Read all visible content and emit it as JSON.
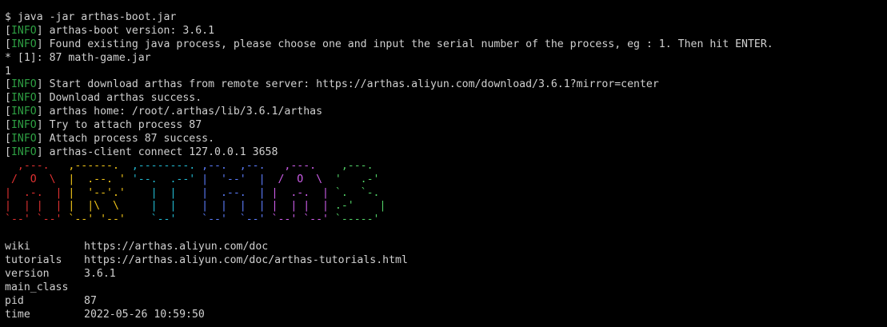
{
  "terminal": {
    "prompt_line": "$ java -jar arthas-boot.jar",
    "info_tag": "INFO",
    "boot_lines": [
      "arthas-boot version: 3.6.1",
      "Found existing java process, please choose one and input the serial number of the process, eg : 1. Then hit ENTER."
    ],
    "process_choice": "* [1]: 87 math-game.jar",
    "user_input": "1",
    "download_lines": [
      "Start download arthas from remote server: https://arthas.aliyun.com/download/3.6.1?mirror=center",
      "Download arthas success.",
      "arthas home: /root/.arthas/lib/3.6.1/arthas",
      "Try to attach process 87",
      "Attach process 87 success.",
      "arthas-client connect 127.0.0.1 3658"
    ],
    "logo": {
      "segments": [
        {
          "letter": "A",
          "color": "#e03131",
          "lines": [
            "  ,---.  ",
            " /  O  \\ ",
            "|  .-.  |",
            "|  | |  |",
            "`--' `--'"
          ]
        },
        {
          "letter": "R",
          "color": "#f0c419",
          "lines": [
            ",------. ",
            "|  .--. '",
            "|  '--'.'",
            "|  |\\  \\ ",
            "`--' '--'"
          ]
        },
        {
          "letter": "T",
          "color": "#22b8cf",
          "lines": [
            ",--------.",
            "'--.  .--'",
            "   |  |   ",
            "   |  |   ",
            "   `--'   "
          ]
        },
        {
          "letter": "H",
          "color": "#5c7cfa",
          "lines": [
            ",--.  ,--.",
            "|  '--'  |",
            "|  .--.  |",
            "|  |  |  |",
            "`--'  `--'"
          ]
        },
        {
          "letter": "A",
          "color": "#cc5de8",
          "lines": [
            "  ,---.  ",
            " /  O  \\ ",
            "|  .-.  |",
            "|  | |  |",
            "`--' `--'"
          ]
        },
        {
          "letter": "S",
          "color": "#51cf66",
          "lines": [
            " ,---.  ",
            "'   .-' ",
            "`.  `-. ",
            ".-'    |",
            "`-----' "
          ]
        }
      ]
    },
    "info_table": [
      {
        "key": "wiki",
        "value": "https://arthas.aliyun.com/doc"
      },
      {
        "key": "tutorials",
        "value": "https://arthas.aliyun.com/doc/arthas-tutorials.html"
      },
      {
        "key": "version",
        "value": "3.6.1"
      },
      {
        "key": "main_class",
        "value": ""
      },
      {
        "key": "pid",
        "value": "87"
      },
      {
        "key": "time",
        "value": "2022-05-26 10:59:50"
      }
    ]
  }
}
